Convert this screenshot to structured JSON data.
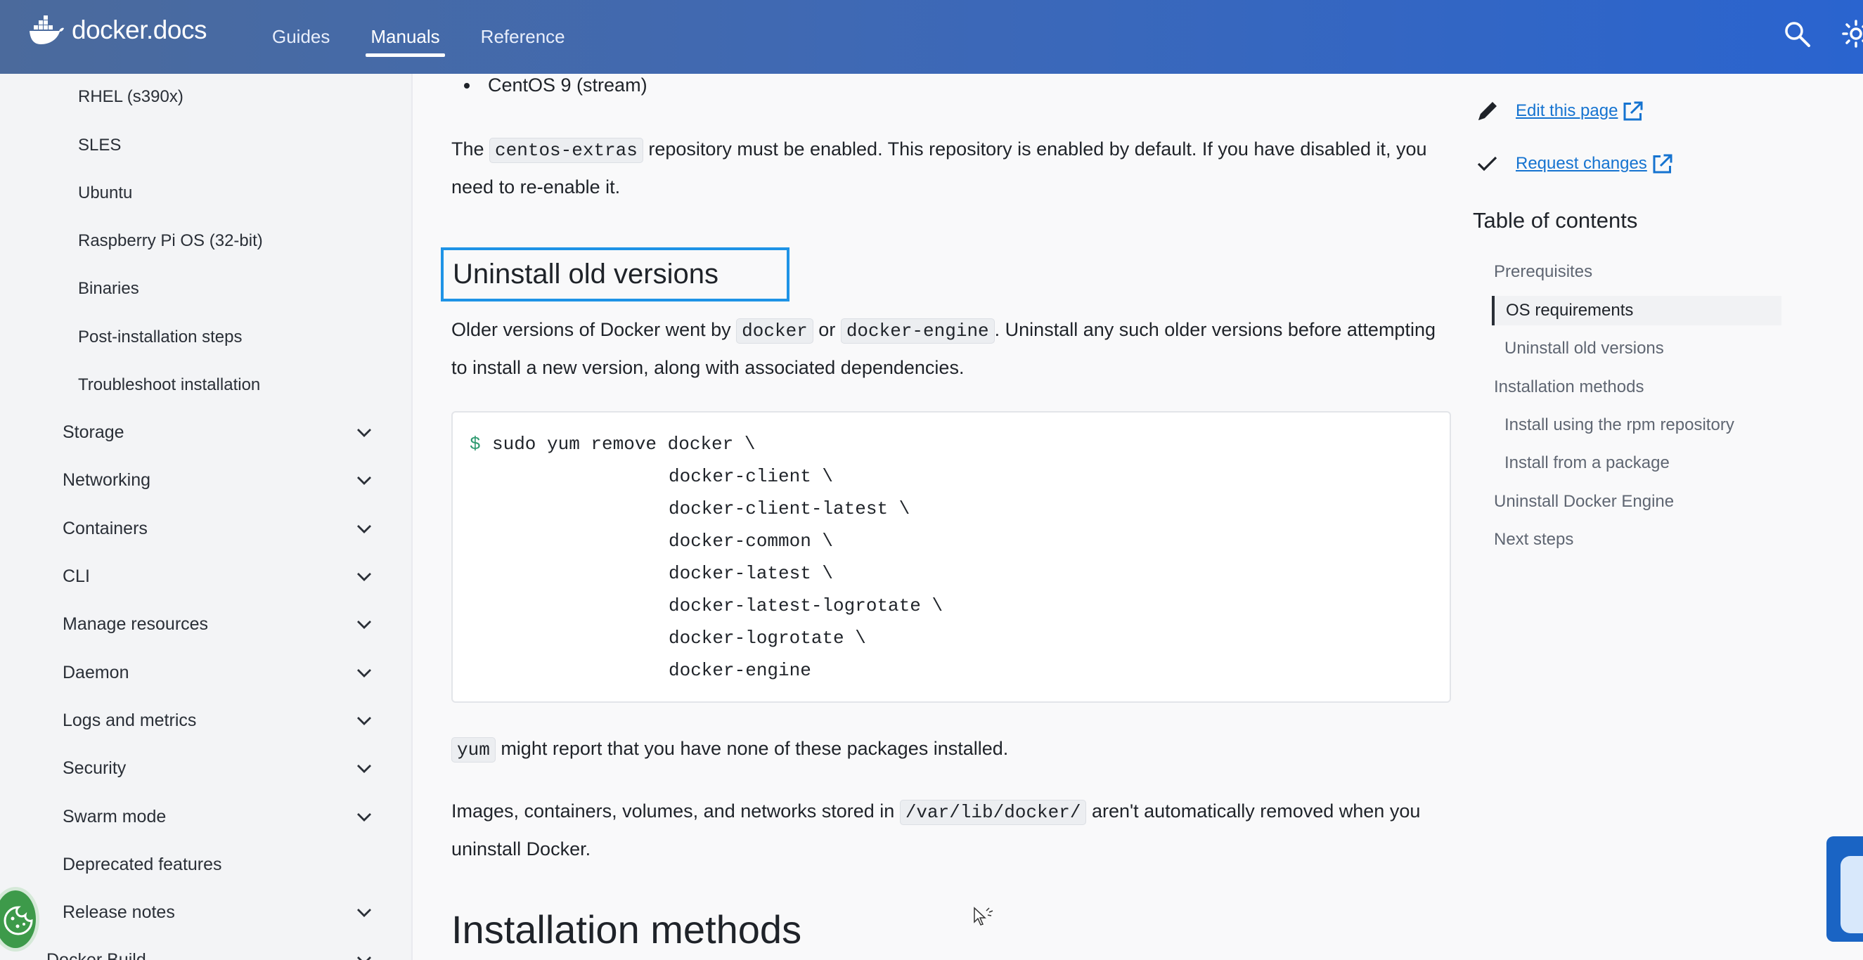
{
  "header": {
    "logo_text": "docker.docs",
    "nav": [
      {
        "label": "Guides",
        "active": false
      },
      {
        "label": "Manuals",
        "active": true
      },
      {
        "label": "Reference",
        "active": false
      }
    ],
    "icons": [
      "search-icon",
      "theme-toggle-icon"
    ]
  },
  "sidebar": {
    "sub_items": [
      "RHEL (s390x)",
      "SLES",
      "Ubuntu",
      "Raspberry Pi OS (32-bit)",
      "Binaries",
      "Post-installation steps",
      "Troubleshoot installation"
    ],
    "sections": [
      {
        "label": "Storage",
        "expandable": true
      },
      {
        "label": "Networking",
        "expandable": true
      },
      {
        "label": "Containers",
        "expandable": true
      },
      {
        "label": "CLI",
        "expandable": true
      },
      {
        "label": "Manage resources",
        "expandable": true
      },
      {
        "label": "Daemon",
        "expandable": true
      },
      {
        "label": "Logs and metrics",
        "expandable": true
      },
      {
        "label": "Security",
        "expandable": true
      },
      {
        "label": "Swarm mode",
        "expandable": true
      },
      {
        "label": "Deprecated features",
        "expandable": false
      },
      {
        "label": "Release notes",
        "expandable": true
      }
    ],
    "cut_off_item": "Docker Build"
  },
  "content": {
    "bullet": "CentOS 9 (stream)",
    "repo_para": {
      "pre": "The ",
      "code": "centos-extras",
      "post": " repository must be enabled. This repository is enabled by default. If you have disabled it, you need to re-enable it."
    },
    "heading": "Uninstall old versions",
    "older_para": {
      "t1": "Older versions of Docker went by ",
      "c1": "docker",
      "t2": " or ",
      "c2": "docker-engine",
      "t3": ". Uninstall any such older versions before attempting to install a new version, along with associated dependencies."
    },
    "code_prompt": "$",
    "code_lines": [
      "sudo yum remove docker \\",
      "docker-client \\",
      "docker-client-latest \\",
      "docker-common \\",
      "docker-latest \\",
      "docker-latest-logrotate \\",
      "docker-logrotate \\",
      "docker-engine"
    ],
    "yum_para": {
      "code": "yum",
      "text": " might report that you have none of these packages installed."
    },
    "images_para": {
      "t1": "Images, containers, volumes, and networks stored in ",
      "code": "/var/lib/docker/",
      "t2": " aren't automatically removed when you uninstall Docker."
    },
    "heading2": "Installation methods"
  },
  "right": {
    "edit_label": "Edit this page",
    "request_label": "Request changes",
    "toc_title": "Table of contents",
    "toc": [
      {
        "label": "Prerequisites",
        "level": 1
      },
      {
        "label": "OS requirements",
        "level": 2,
        "active": true
      },
      {
        "label": "Uninstall old versions",
        "level": 2
      },
      {
        "label": "Installation methods",
        "level": 1
      },
      {
        "label": "Install using the rpm repository",
        "level": 2
      },
      {
        "label": "Install from a package",
        "level": 2
      },
      {
        "label": "Uninstall Docker Engine",
        "level": 1
      },
      {
        "label": "Next steps",
        "level": 1
      }
    ]
  },
  "colors": {
    "header_start": "#4b6a9c",
    "header_end": "#2a64cf",
    "link": "#1573d0",
    "heading_highlight": "#1e93e6",
    "prompt": "#2e9a70"
  }
}
